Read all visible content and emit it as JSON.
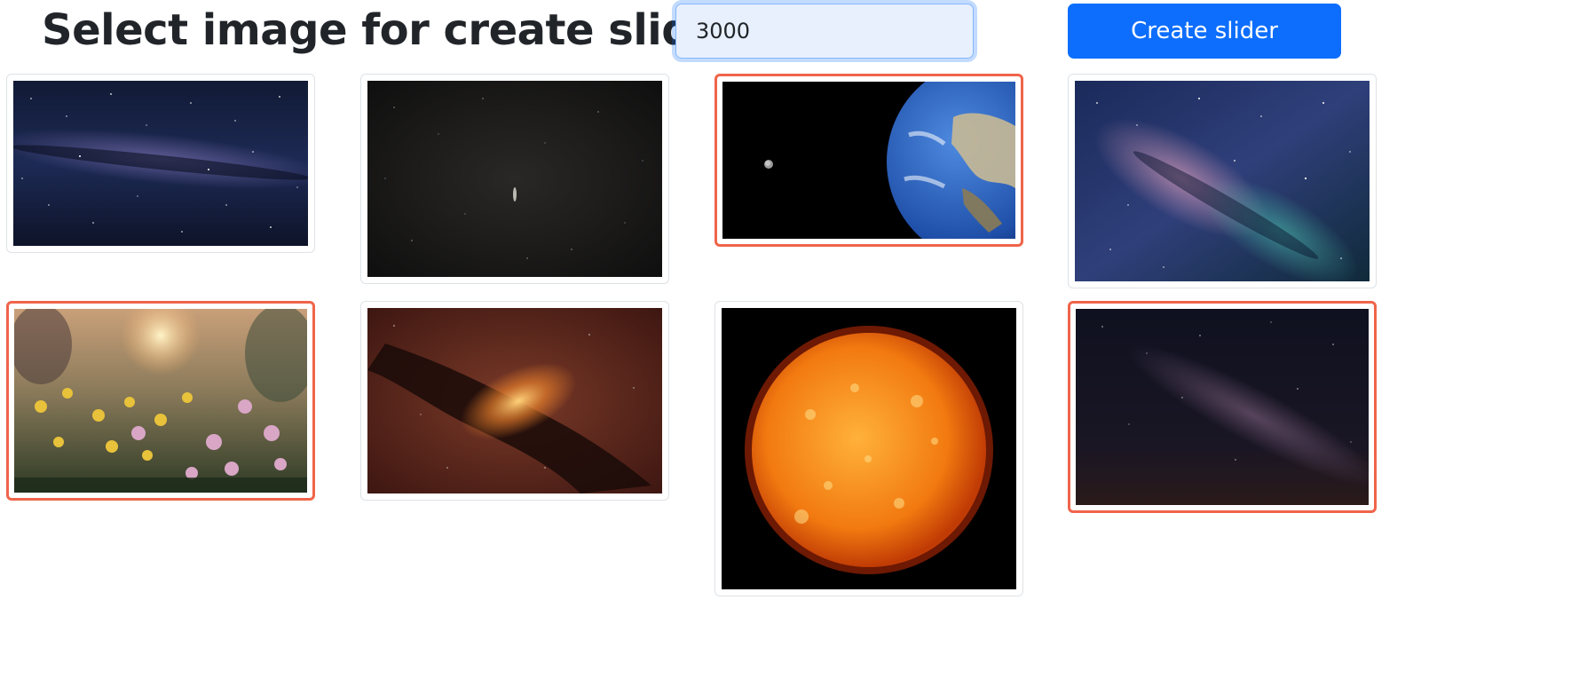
{
  "header": {
    "title": "Select image for create slider",
    "duration_value": "3000",
    "create_button_label": "Create slider"
  },
  "colors": {
    "primary": "#0d6efd",
    "selected_border": "#f0644a",
    "card_border": "#dee2e6"
  },
  "gallery": {
    "images": [
      {
        "subject": "milky-way-panorama",
        "selected": false
      },
      {
        "subject": "dark-starfield-galaxy",
        "selected": false
      },
      {
        "subject": "earth-and-moon",
        "selected": true
      },
      {
        "subject": "milky-way-colorful",
        "selected": false
      },
      {
        "subject": "flowers-at-sunset",
        "selected": true
      },
      {
        "subject": "red-nebula",
        "selected": false
      },
      {
        "subject": "sun",
        "selected": false
      },
      {
        "subject": "night-sky-milky-way",
        "selected": true
      }
    ]
  }
}
